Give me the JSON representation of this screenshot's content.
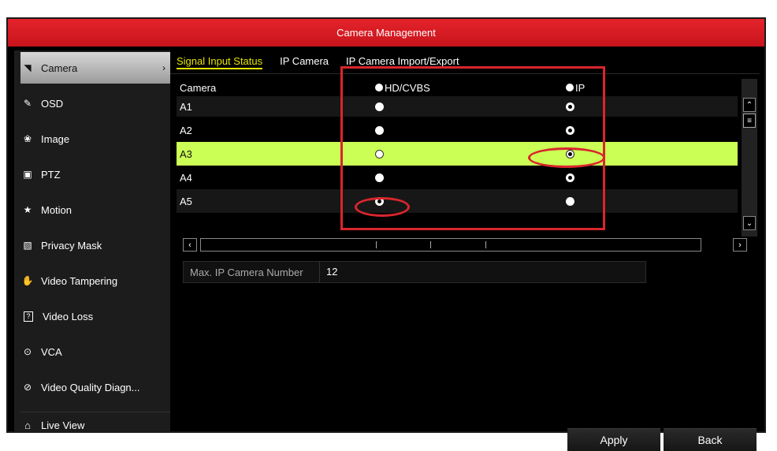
{
  "window": {
    "title": "Camera Management"
  },
  "sidebar": {
    "items": [
      {
        "label": "Camera",
        "icon": "camera-icon",
        "glyph": "◥",
        "active": true
      },
      {
        "label": "OSD",
        "icon": "osd-icon",
        "glyph": "✎"
      },
      {
        "label": "Image",
        "icon": "image-icon",
        "glyph": "❀"
      },
      {
        "label": "PTZ",
        "icon": "ptz-icon",
        "glyph": "▣"
      },
      {
        "label": "Motion",
        "icon": "motion-icon",
        "glyph": "★"
      },
      {
        "label": "Privacy Mask",
        "icon": "privacy-mask-icon",
        "glyph": "▧"
      },
      {
        "label": "Video Tampering",
        "icon": "video-tampering-icon",
        "glyph": "✋"
      },
      {
        "label": "Video Loss",
        "icon": "video-loss-icon",
        "glyph": "?"
      },
      {
        "label": "VCA",
        "icon": "vca-icon",
        "glyph": "⊙"
      },
      {
        "label": "Video Quality Diagn...",
        "icon": "video-quality-icon",
        "glyph": "⊘"
      }
    ],
    "live_view": {
      "label": "Live View",
      "icon": "home-icon",
      "glyph": "⌂"
    }
  },
  "tabs": [
    {
      "label": "Signal Input Status",
      "active": true
    },
    {
      "label": "IP Camera"
    },
    {
      "label": "IP Camera Import/Export"
    }
  ],
  "table": {
    "headers": {
      "camera": "Camera",
      "hd": "HD/CVBS",
      "ip": "IP"
    },
    "rows": [
      {
        "name": "A1",
        "hd": "filled",
        "ip": "dot"
      },
      {
        "name": "A2",
        "hd": "filled",
        "ip": "dot"
      },
      {
        "name": "A3",
        "hd": "empty",
        "ip": "dot",
        "selected": true
      },
      {
        "name": "A4",
        "hd": "filled",
        "ip": "dot"
      },
      {
        "name": "A5",
        "hd": "dot",
        "ip": "filled"
      }
    ]
  },
  "max_ip_camera": {
    "label": "Max. IP Camera Number",
    "value": "12"
  },
  "buttons": {
    "apply": "Apply",
    "back": "Back"
  },
  "colors": {
    "title_bar": "#d81e25",
    "selected_row": "#ccff55",
    "active_tab": "#e6e600",
    "annotation": "#d8262c"
  }
}
